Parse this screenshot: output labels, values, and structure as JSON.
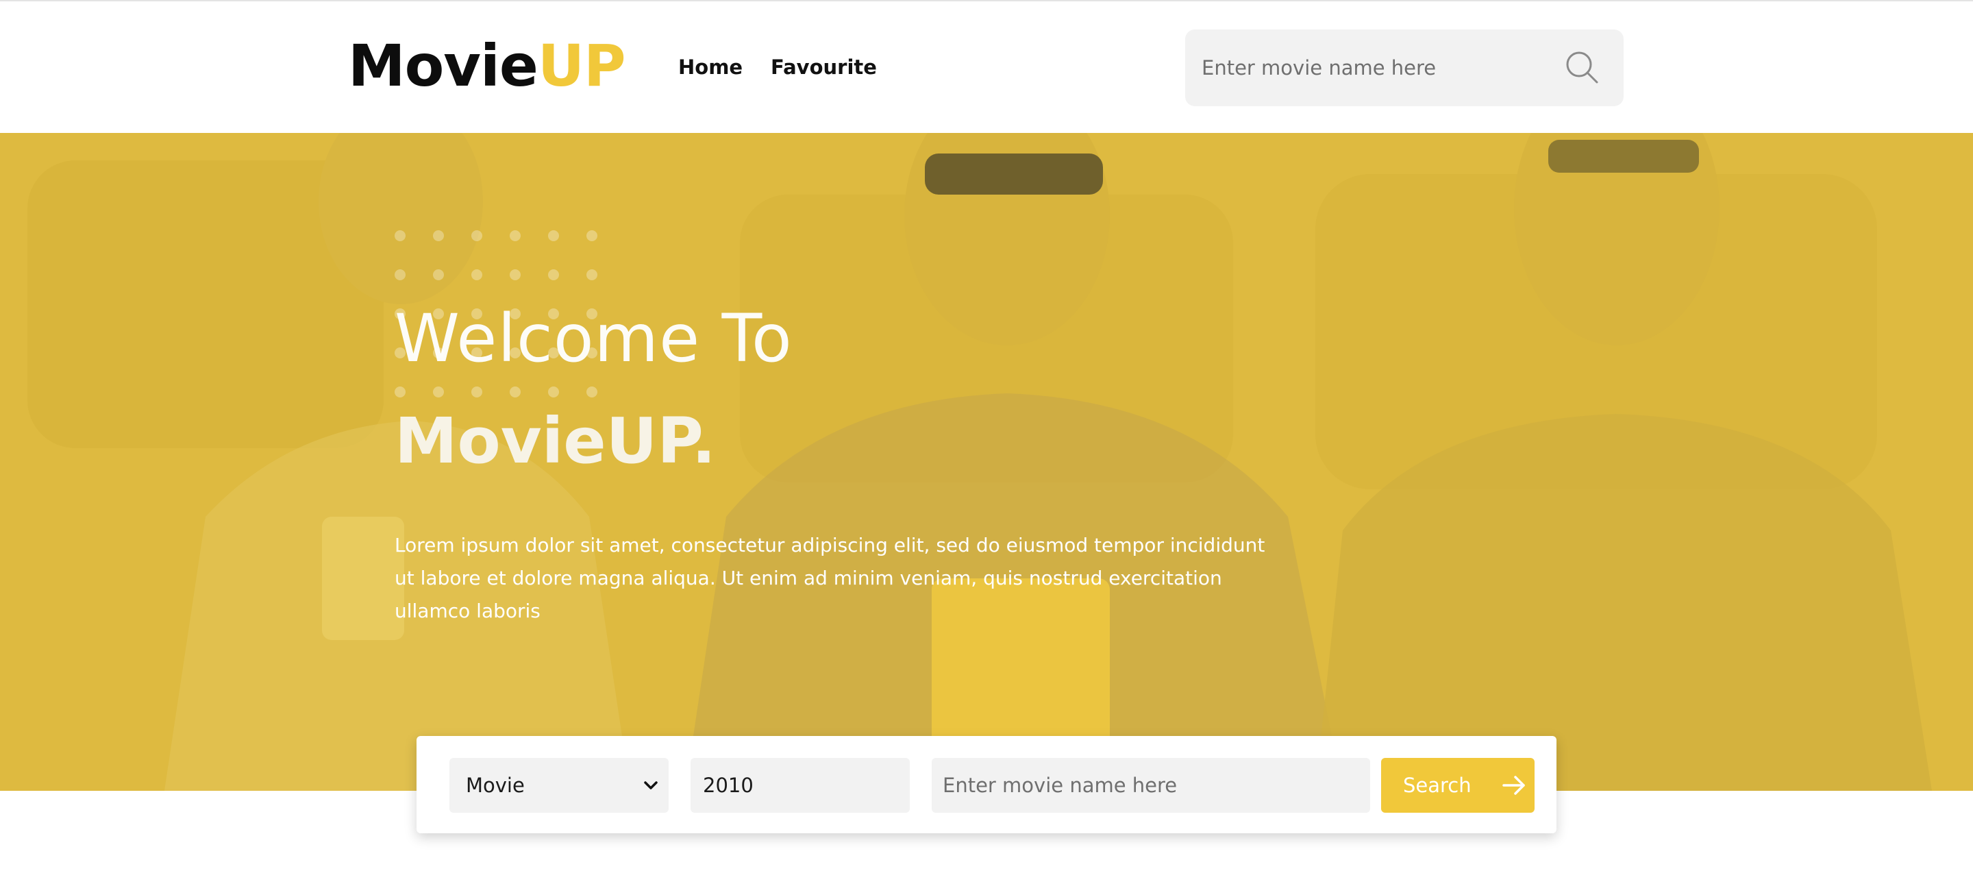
{
  "header": {
    "logo_main": "Movie",
    "logo_accent": "UP",
    "nav": [
      {
        "label": "Home"
      },
      {
        "label": "Favourite"
      }
    ],
    "search": {
      "placeholder": "Enter movie name here",
      "icon": "search-icon"
    }
  },
  "hero": {
    "welcome": "Welcome To",
    "brand": "MovieUP.",
    "description": "Lorem ipsum dolor sit amet, consectetur adipiscing elit, sed do eiusmod tempor incididunt ut labore et dolore magna aliqua. Ut enim ad minim veniam, quis nostrud exercitation ullamco laboris"
  },
  "search_panel": {
    "type_selected": "Movie",
    "year_value": "2010",
    "name_placeholder": "Enter movie name here",
    "button_label": "Search",
    "button_icon": "arrow-right-icon",
    "select_icon": "chevron-down-icon"
  },
  "colors": {
    "accent": "#f1c83a",
    "hero_overlay": "#dbb842",
    "text_dark": "#0d0d0d",
    "field_bg": "#f2f2f2"
  }
}
